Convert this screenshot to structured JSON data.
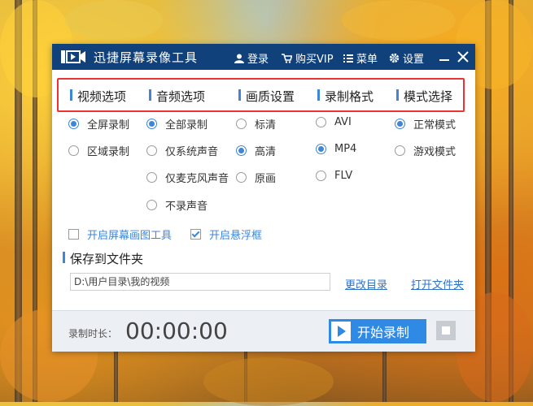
{
  "window": {
    "title": "迅捷屏幕录像工具",
    "login": "登录",
    "buy_vip": "购买VIP",
    "menu": "菜单",
    "settings": "设置"
  },
  "tabs": [
    {
      "label": "视频选项"
    },
    {
      "label": "音频选项"
    },
    {
      "label": "画质设置"
    },
    {
      "label": "录制格式"
    },
    {
      "label": "模式选择"
    }
  ],
  "video_options": [
    {
      "label": "全屏录制",
      "selected": true
    },
    {
      "label": "区域录制",
      "selected": false
    }
  ],
  "audio_options": [
    {
      "label": "全部录制",
      "selected": true
    },
    {
      "label": "仅系统声音",
      "selected": false
    },
    {
      "label": "仅麦克风声音",
      "selected": false
    },
    {
      "label": "不录声音",
      "selected": false
    }
  ],
  "quality_options": [
    {
      "label": "标清",
      "selected": false
    },
    {
      "label": "高清",
      "selected": true
    },
    {
      "label": "原画",
      "selected": false
    }
  ],
  "format_options": [
    {
      "label": "AVI",
      "selected": false
    },
    {
      "label": "MP4",
      "selected": true
    },
    {
      "label": "FLV",
      "selected": false
    }
  ],
  "mode_options": [
    {
      "label": "正常模式",
      "selected": true
    },
    {
      "label": "游戏模式",
      "selected": false
    }
  ],
  "checkboxes": {
    "screen_draw": {
      "label": "开启屏幕画图工具",
      "checked": false
    },
    "float_window": {
      "label": "开启悬浮框",
      "checked": true
    }
  },
  "save": {
    "title": "保存到文件夹",
    "path": "D:\\用户目录\\我的视频",
    "change_dir": "更改目录",
    "open_folder": "打开文件夹"
  },
  "bottom": {
    "duration_label": "录制时长：",
    "duration_value": "00:00:00",
    "start_label": "开始录制"
  },
  "colors": {
    "titlebar": "#11417a",
    "accent": "#3d86d8",
    "highlight_border": "#ee3333",
    "start_button": "#2f8ae5"
  }
}
